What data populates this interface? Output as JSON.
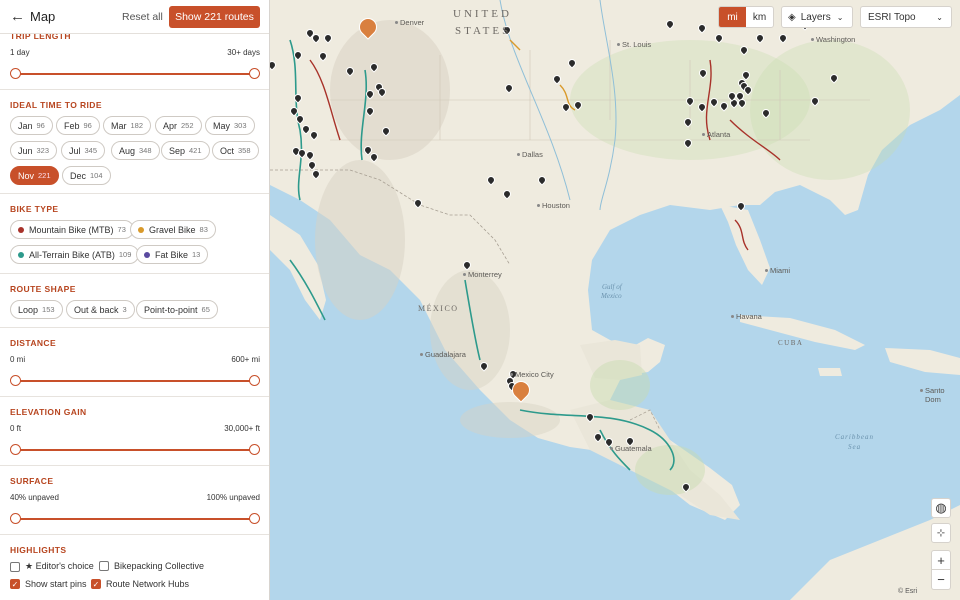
{
  "topbar": {
    "back_icon": "←",
    "title": "Map",
    "reset": "Reset all",
    "show": "Show 221 routes"
  },
  "trip_length": {
    "title": "TRIP LENGTH",
    "min": "1 day",
    "max": "30+ days"
  },
  "ideal_time": {
    "title": "IDEAL TIME TO RIDE",
    "months": [
      {
        "label": "Jan",
        "count": "96"
      },
      {
        "label": "Feb",
        "count": "96"
      },
      {
        "label": "Mar",
        "count": "182"
      },
      {
        "label": "Apr",
        "count": "252"
      },
      {
        "label": "May",
        "count": "303"
      },
      {
        "label": "Jun",
        "count": "323"
      },
      {
        "label": "Jul",
        "count": "345"
      },
      {
        "label": "Aug",
        "count": "348"
      },
      {
        "label": "Sep",
        "count": "421"
      },
      {
        "label": "Oct",
        "count": "358"
      },
      {
        "label": "Nov",
        "count": "221",
        "selected": true
      },
      {
        "label": "Dec",
        "count": "104"
      }
    ]
  },
  "bike_type": {
    "title": "BIKE TYPE",
    "items": [
      {
        "label": "Mountain Bike (MTB)",
        "count": "73",
        "color": "#a8322a"
      },
      {
        "label": "Gravel Bike",
        "count": "83",
        "color": "#d99a2b"
      },
      {
        "label": "All-Terrain Bike (ATB)",
        "count": "109",
        "color": "#2d9a8c"
      },
      {
        "label": "Fat Bike",
        "count": "13",
        "color": "#5a4aa0"
      }
    ]
  },
  "route_shape": {
    "title": "ROUTE SHAPE",
    "items": [
      {
        "label": "Loop",
        "count": "153"
      },
      {
        "label": "Out & back",
        "count": "3"
      },
      {
        "label": "Point-to-point",
        "count": "65"
      }
    ]
  },
  "distance": {
    "title": "DISTANCE",
    "min": "0 mi",
    "max": "600+ mi"
  },
  "elevation": {
    "title": "ELEVATION GAIN",
    "min": "0 ft",
    "max": "30,000+ ft"
  },
  "surface": {
    "title": "SURFACE",
    "min": "40% unpaved",
    "max": "100% unpaved"
  },
  "highlights": {
    "title": "HIGHLIGHTS",
    "items": [
      {
        "label": "★ Editor's choice",
        "checked": false
      },
      {
        "label": "Bikepacking Collective",
        "checked": false
      },
      {
        "label": "Show start pins",
        "checked": true
      },
      {
        "label": "Route Network Hubs",
        "checked": true
      }
    ]
  },
  "map": {
    "units": {
      "mi": "mi",
      "km": "km"
    },
    "layers": "Layers",
    "basemap": "ESRI Topo",
    "zoom_in": "+",
    "zoom_out": "−",
    "attribution": "© Esri",
    "labels": {
      "country_us_1": "UNITED",
      "country_us_2": "STATES",
      "mexico": "MÉXICO",
      "cuba": "CUBA",
      "gulf_1": "Gulf of",
      "gulf_2": "Mexico",
      "caribbean_1": "Caribbean",
      "caribbean_2": "Sea",
      "denver": "Denver",
      "stlouis": "St. Louis",
      "washington": "Washington",
      "dallas": "Dallas",
      "atlanta": "Atlanta",
      "houston": "Houston",
      "monterrey": "Monterrey",
      "miami": "Miami",
      "havana": "Havana",
      "guadalajara": "Guadalajara",
      "mexico_city": "Mexico City",
      "guatemala": "Guatemala",
      "santo": "Santo Dom"
    }
  },
  "colors": {
    "accent": "#c8502a",
    "land": "#f1ede2",
    "water": "#b6d8ec"
  }
}
